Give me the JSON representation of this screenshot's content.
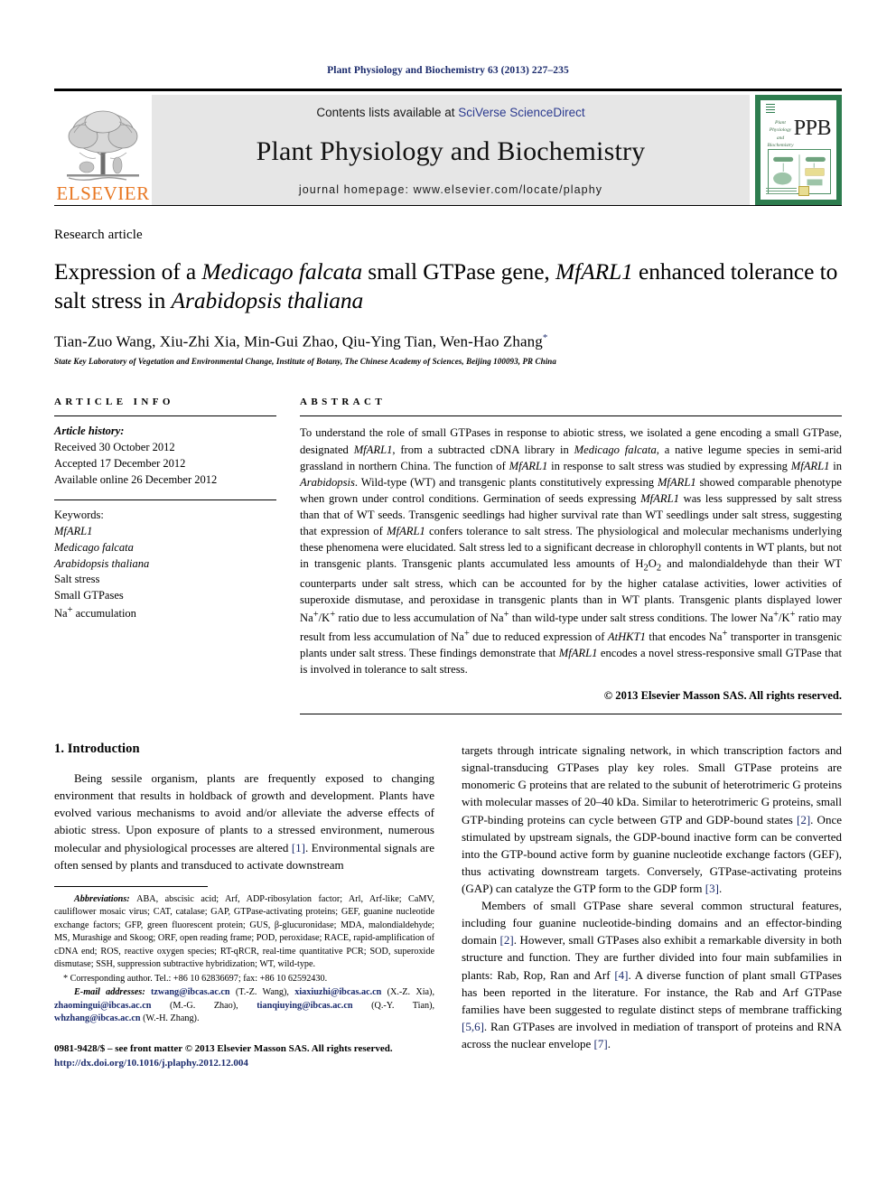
{
  "running_head": "Plant Physiology and Biochemistry 63 (2013) 227–235",
  "masthead": {
    "elsevier_wordmark": "ELSEVIER",
    "contents_prefix": "Contents lists available at ",
    "contents_link": "SciVerse ScienceDirect",
    "journal_title": "Plant Physiology and Biochemistry",
    "homepage": "journal homepage: www.elsevier.com/locate/plaphy",
    "cover_abbrev": "PPB",
    "cover_title": "Plant Physiology and Biochemistry",
    "accent_orange": "#E87722",
    "accent_blue": "#1a2a6c",
    "cover_green": "#2e7d4f",
    "banner_grey": "#e6e6e6"
  },
  "article": {
    "type": "Research article",
    "title_part1": "Expression of a ",
    "title_italic1": "Medicago falcata",
    "title_part2": " small GTPase gene, ",
    "title_italic2": "MfARL1",
    "title_part3": " enhanced tolerance to salt stress in ",
    "title_italic3": "Arabidopsis thaliana",
    "authors": "Tian-Zuo Wang, Xiu-Zhi Xia, Min-Gui Zhao, Qiu-Ying Tian, Wen-Hao Zhang",
    "corresponding_marker": "*",
    "affiliation": "State Key Laboratory of Vegetation and Environmental Change, Institute of Botany, The Chinese Academy of Sciences, Beijing 100093, PR China"
  },
  "article_info": {
    "heading": "ARTICLE INFO",
    "history_label": "Article history:",
    "history": [
      "Received 30 October 2012",
      "Accepted 17 December 2012",
      "Available online 26 December 2012"
    ],
    "keywords_label": "Keywords:",
    "keywords": [
      "MfARL1",
      "Medicago falcata",
      "Arabidopsis thaliana",
      "Salt stress",
      "Small GTPases",
      "Na+ accumulation"
    ]
  },
  "abstract": {
    "heading": "ABSTRACT",
    "copyright": "© 2013 Elsevier Masson SAS. All rights reserved."
  },
  "introduction": {
    "heading": "1. Introduction",
    "left_paragraph": "Being sessile organism, plants are frequently exposed to changing environment that results in holdback of growth and development. Plants have evolved various mechanisms to avoid and/or alleviate the adverse effects of abiotic stress. Upon exposure of plants to a stressed environment, numerous molecular and physiological processes are altered [1]. Environmental signals are often sensed by plants and transduced to activate downstream",
    "right_paragraph_1": "targets through intricate signaling network, in which transcription factors and signal-transducing GTPases play key roles. Small GTPase proteins are monomeric G proteins that are related to the subunit of heterotrimeric G proteins with molecular masses of 20–40 kDa. Similar to heterotrimeric G proteins, small GTP-binding proteins can cycle between GTP and GDP-bound states [2]. Once stimulated by upstream signals, the GDP-bound inactive form can be converted into the GTP-bound active form by guanine nucleotide exchange factors (GEF), thus activating downstream targets. Conversely, GTPase-activating proteins (GAP) can catalyze the GTP form to the GDP form [3].",
    "right_paragraph_2": "Members of small GTPase share several common structural features, including four guanine nucleotide-binding domains and an effector-binding domain [2]. However, small GTPases also exhibit a remarkable diversity in both structure and function. They are further divided into four main subfamilies in plants: Rab, Rop, Ran and Arf [4]. A diverse function of plant small GTPases has been reported in the literature. For instance, the Rab and Arf GTPase families have been suggested to regulate distinct steps of membrane trafficking [5,6]. Ran GTPases are involved in mediation of transport of proteins and RNA across the nuclear envelope [7]."
  },
  "footnotes": {
    "abbreviations_label": "Abbreviations:",
    "abbreviations_text": " ABA, abscisic acid; Arf, ADP-ribosylation factor; Arl, Arf-like; CaMV, cauliflower mosaic virus; CAT, catalase; GAP, GTPase-activating proteins; GEF, guanine nucleotide exchange factors; GFP, green fluorescent protein; GUS, β-glucuronidase; MDA, malondialdehyde; MS, Murashige and Skoog; ORF, open reading frame; POD, peroxidase; RACE, rapid-amplification of cDNA end; ROS, reactive oxygen species; RT-qRCR, real-time quantitative PCR; SOD, superoxide dismutase; SSH, suppression subtractive hybridization; WT, wild-type.",
    "corresponding": "* Corresponding author. Tel.: +86 10 62836697; fax: +86 10 62592430.",
    "email_label": "E-mail addresses:",
    "emails": [
      {
        "address": "tzwang@ibcas.ac.cn",
        "person": "(T.-Z. Wang)"
      },
      {
        "address": "xiaxiuzhi@ibcas.ac.cn",
        "person": "(X.-Z. Xia)"
      },
      {
        "address": "zhaomingui@ibcas.ac.cn",
        "person": "(M.-G. Zhao)"
      },
      {
        "address": "tianqiuying@ibcas.ac.cn",
        "person": "(Q.-Y. Tian)"
      },
      {
        "address": "whzhang@ibcas.ac.cn",
        "person": "(W.-H. Zhang)"
      }
    ],
    "issn_line": "0981-9428/$ – see front matter © 2013 Elsevier Masson SAS. All rights reserved.",
    "doi": "http://dx.doi.org/10.1016/j.plaphy.2012.12.004"
  }
}
